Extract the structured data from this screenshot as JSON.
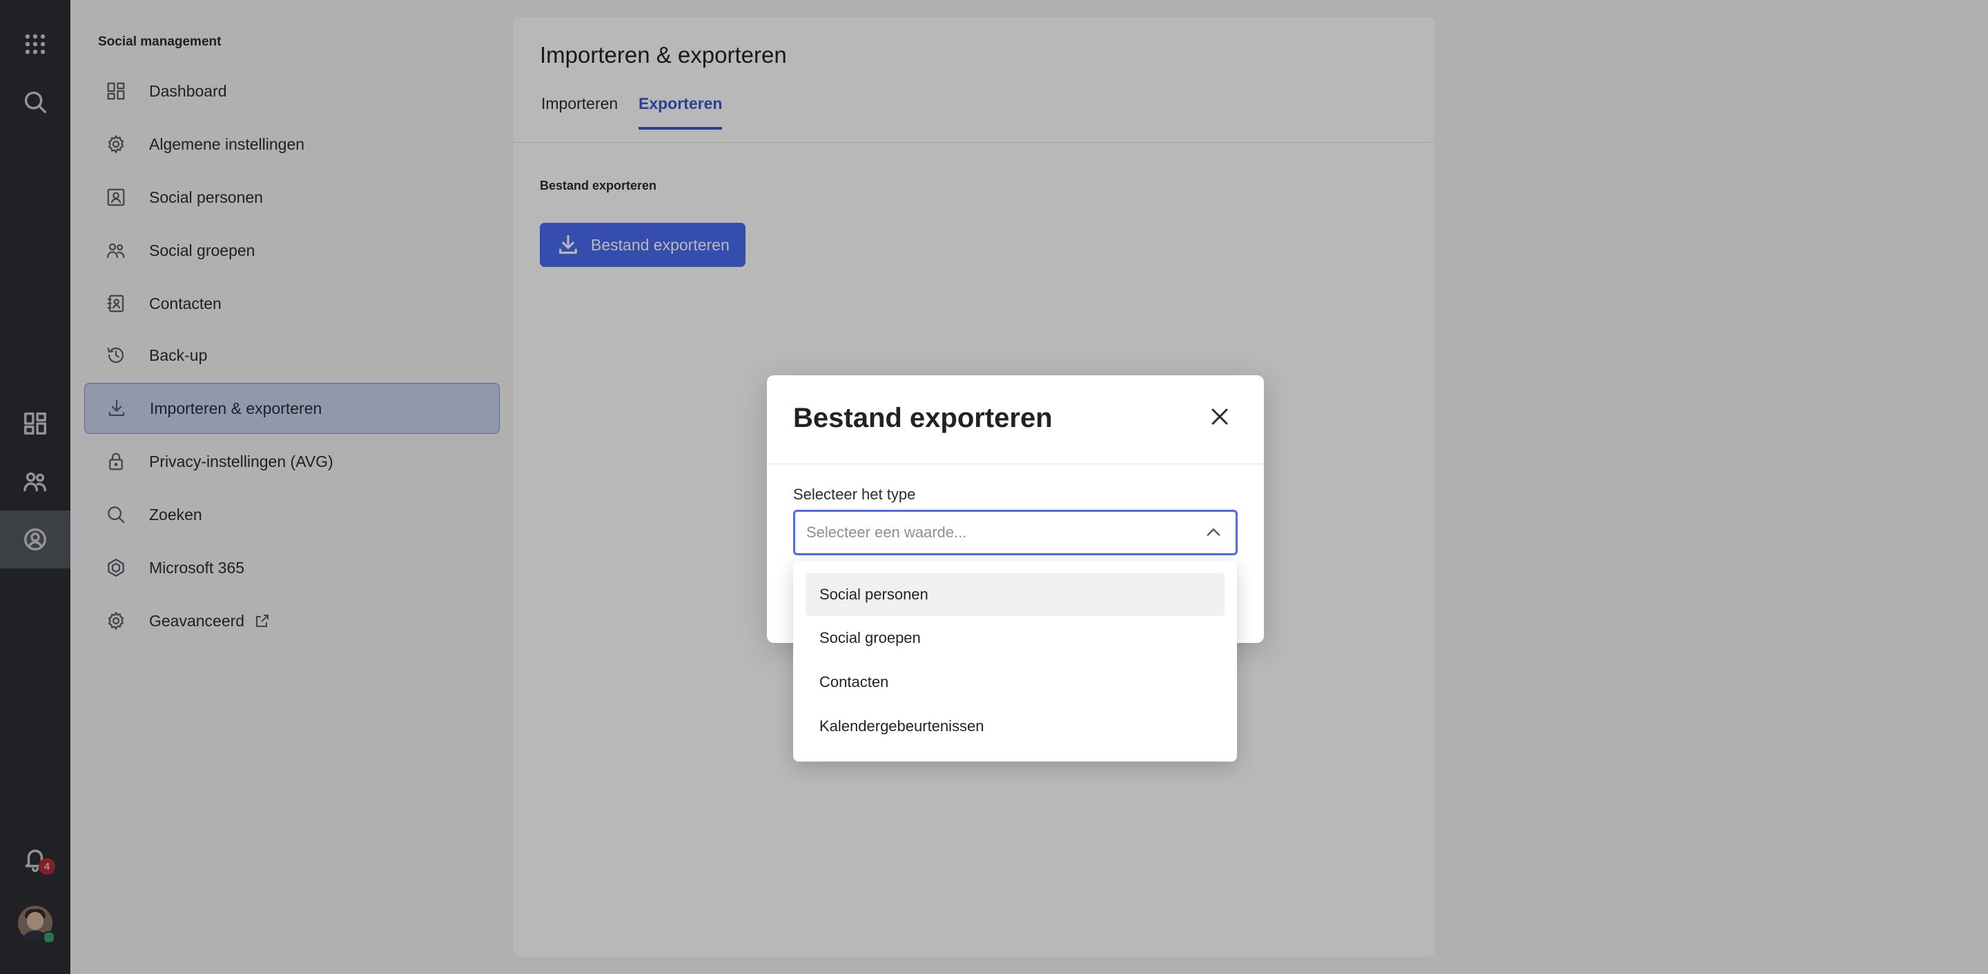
{
  "rail": {
    "notifications_count": "4",
    "icons": [
      "apps-grid-icon",
      "search-icon",
      "dashboard-icon",
      "people-icon",
      "social-management-icon",
      "bell-icon"
    ]
  },
  "sidebar": {
    "title": "Social management",
    "items": [
      {
        "label": "Dashboard",
        "icon": "dashboard-icon"
      },
      {
        "label": "Algemene instellingen",
        "icon": "gear-icon"
      },
      {
        "label": "Social personen",
        "icon": "person-card-icon"
      },
      {
        "label": "Social groepen",
        "icon": "people-icon"
      },
      {
        "label": "Contacten",
        "icon": "contact-book-icon"
      },
      {
        "label": "Back-up",
        "icon": "history-icon"
      },
      {
        "label": "Importeren & exporteren",
        "icon": "download-icon",
        "active": true
      },
      {
        "label": "Privacy-instellingen (AVG)",
        "icon": "lock-icon"
      },
      {
        "label": "Zoeken",
        "icon": "search-icon"
      },
      {
        "label": "Microsoft 365",
        "icon": "microsoft-365-icon"
      },
      {
        "label": "Geavanceerd",
        "icon": "gear-icon",
        "external": true
      }
    ]
  },
  "main": {
    "title": "Importeren & exporteren",
    "tabs": [
      {
        "label": "Importeren",
        "active": false
      },
      {
        "label": "Exporteren",
        "active": true
      }
    ],
    "section_label": "Bestand exporteren",
    "export_button_label": "Bestand exporteren"
  },
  "modal": {
    "title": "Bestand exporteren",
    "field_label": "Selecteer het type",
    "select_placeholder": "Selecteer een waarde...",
    "options": [
      "Social personen",
      "Social groepen",
      "Contacten",
      "Kalendergebeurtenissen"
    ],
    "highlighted_option": "Social personen"
  },
  "colors": {
    "accent": "#4a6cf0",
    "rail_bg": "#2c2f33",
    "active_nav_bg": "#cad3ef",
    "badge": "#b32d3b"
  }
}
